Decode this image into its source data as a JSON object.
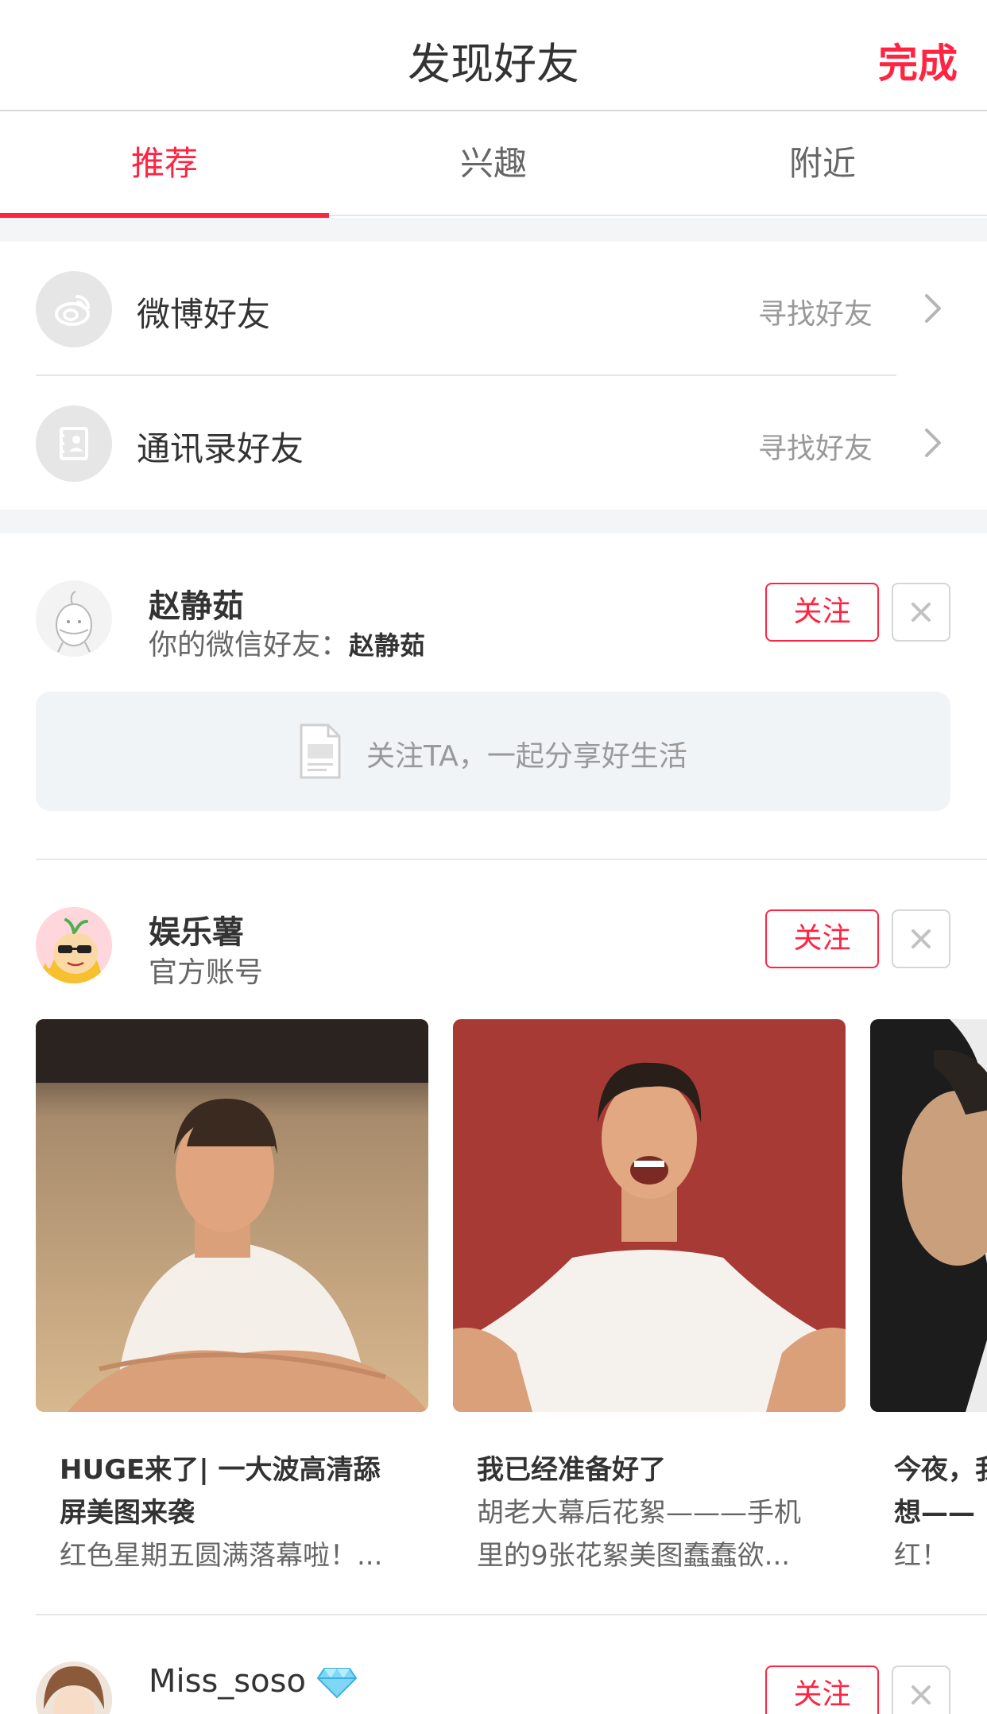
{
  "nav": {
    "title": "发现好友",
    "done": "完成"
  },
  "tabs": [
    {
      "label": "推荐"
    },
    {
      "label": "兴趣"
    },
    {
      "label": "附近"
    }
  ],
  "find_friends": [
    {
      "label": "微博好友",
      "action": "寻找好友",
      "icon": "weibo-icon"
    },
    {
      "label": "通讯录好友",
      "action": "寻找好友",
      "icon": "contacts-icon"
    }
  ],
  "users": [
    {
      "name": "赵静茹",
      "subtitle_prefix": "你的微信好友：",
      "subtitle_name": "赵静茹",
      "follow": "关注",
      "empty_text": "关注TA，一起分享好生活"
    },
    {
      "name": "娱乐薯",
      "subtitle": "官方账号",
      "follow": "关注",
      "cards": [
        {
          "title_line1": "HUGE来了| 一大波高清舔",
          "title_line2": "屏美图来袭",
          "desc": "红色星期五圆满落幕啦！..."
        },
        {
          "title_line1": "我已经准备好了",
          "desc_line1": "胡老大幕后花絮———手机",
          "desc_line2": "里的9张花絮美图蠢蠢欲..."
        },
        {
          "title_line1": "今夜，我",
          "title_line2": "想——",
          "desc": "红！"
        }
      ]
    },
    {
      "name": "Miss_soso",
      "follow": "关注"
    }
  ],
  "colors": {
    "accent": "#ff2442",
    "divider": "#e6e6e6",
    "gap": "#f4f5f7"
  }
}
